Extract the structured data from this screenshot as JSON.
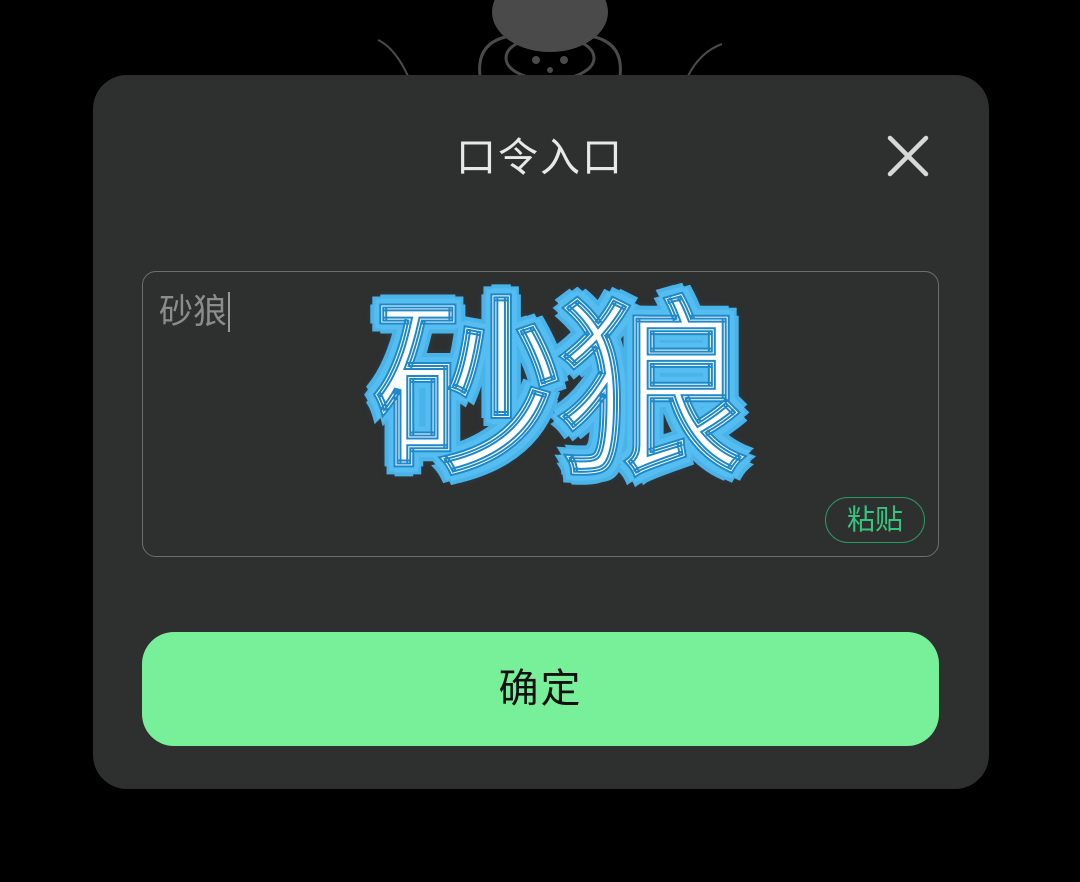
{
  "dialog": {
    "title": "口令入口",
    "close_icon": "close-icon",
    "input": {
      "value": "砂狼",
      "overlay_caption": "砂狼"
    },
    "paste_label": "粘贴",
    "confirm_label": "确定"
  },
  "colors": {
    "background": "#000000",
    "dialog": "#2e2f2f",
    "accent_green": "#78f09a",
    "paste_green": "#38c47f",
    "overlay_outline": "#4ab3ea"
  }
}
